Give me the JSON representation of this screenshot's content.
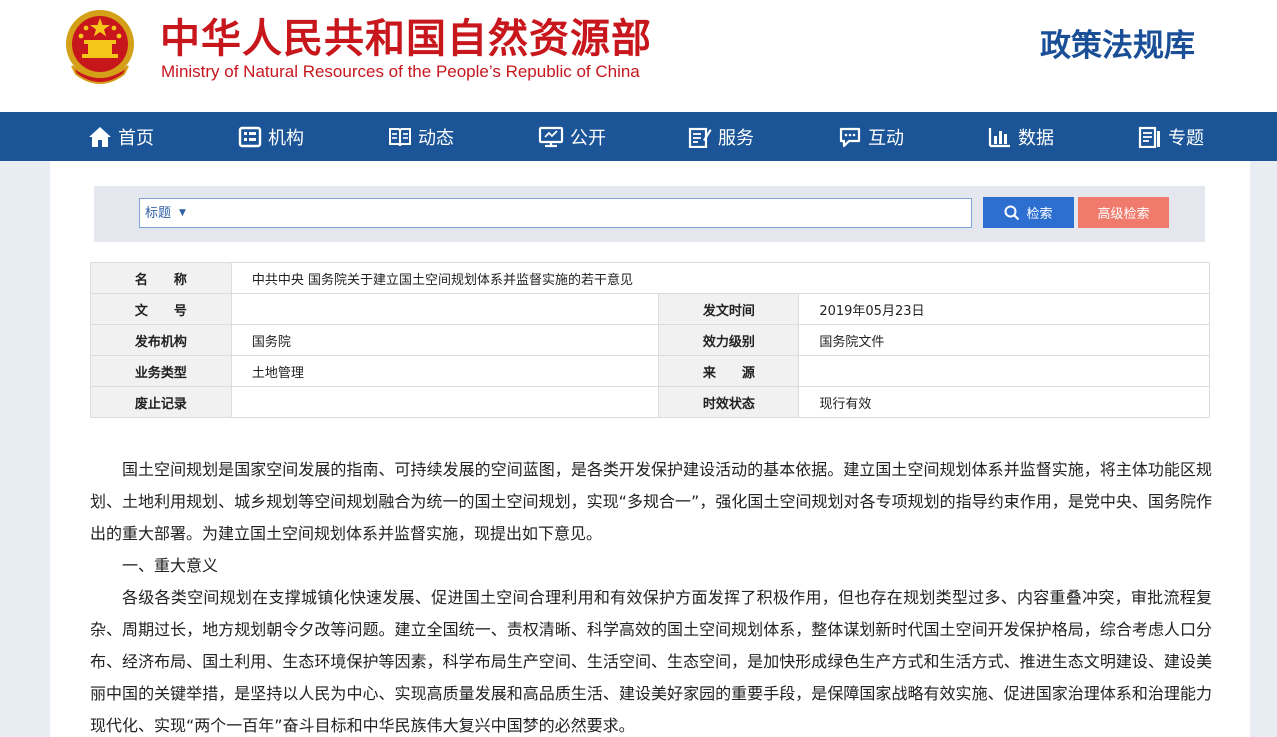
{
  "header": {
    "title_cn": "中华人民共和国自然资源部",
    "title_en": "Ministry of Natural Resources of the People’s Republic of China",
    "library_title": "政策法规库"
  },
  "colors": {
    "brand_red": "#c8161d",
    "nav_blue": "#1b5597",
    "search_blue": "#2c6fd1",
    "advanced_salmon": "#f07a6c"
  },
  "nav": {
    "items": [
      {
        "label": "首页",
        "icon": "home-icon"
      },
      {
        "label": "机构",
        "icon": "org-icon"
      },
      {
        "label": "动态",
        "icon": "book-icon"
      },
      {
        "label": "公开",
        "icon": "monitor-icon"
      },
      {
        "label": "服务",
        "icon": "service-icon"
      },
      {
        "label": "互动",
        "icon": "chat-icon"
      },
      {
        "label": "数据",
        "icon": "chart-icon"
      },
      {
        "label": "专题",
        "icon": "topic-icon"
      }
    ]
  },
  "search": {
    "field_selected": "标题",
    "input_value": "",
    "search_button": "检索",
    "advanced_button": "高级检索"
  },
  "meta": {
    "name_label": "名　　称",
    "name_value": "中共中央 国务院关于建立国土空间规划体系并监督实施的若干意见",
    "doc_no_label": "文　　号",
    "doc_no_value": "",
    "date_label": "发文时间",
    "date_value": "2019年05月23日",
    "issuer_label": "发布机构",
    "issuer_value": "国务院",
    "level_label": "效力级别",
    "level_value": "国务院文件",
    "category_label": "业务类型",
    "category_value": "土地管理",
    "source_label": "来　　源",
    "source_value": "",
    "abolish_label": "废止记录",
    "abolish_value": "",
    "status_label": "时效状态",
    "status_value": "现行有效"
  },
  "article": {
    "p1": "国土空间规划是国家空间发展的指南、可持续发展的空间蓝图，是各类开发保护建设活动的基本依据。建立国土空间规划体系并监督实施，将主体功能区规划、土地利用规划、城乡规划等空间规划融合为统一的国土空间规划，实现“多规合一”，强化国土空间规划对各专项规划的指导约束作用，是党中央、国务院作出的重大部署。为建立国土空间规划体系并监督实施，现提出如下意见。",
    "heading1": "一、重大意义",
    "p2": "各级各类空间规划在支撑城镇化快速发展、促进国土空间合理利用和有效保护方面发挥了积极作用，但也存在规划类型过多、内容重叠冲突，审批流程复杂、周期过长，地方规划朝令夕改等问题。建立全国统一、责权清晰、科学高效的国土空间规划体系，整体谋划新时代国土空间开发保护格局，综合考虑人口分布、经济布局、国土利用、生态环境保护等因素，科学布局生产空间、生活空间、生态空间，是加快形成绿色生产方式和生活方式、推进生态文明建设、建设美丽中国的关键举措，是坚持以人民为中心、实现高质量发展和高品质生活、建设美好家园的重要手段，是保障国家战略有效实施、促进国家治理体系和治理能力现代化、实现“两个一百年”奋斗目标和中华民族伟大复兴中国梦的必然要求。"
  }
}
